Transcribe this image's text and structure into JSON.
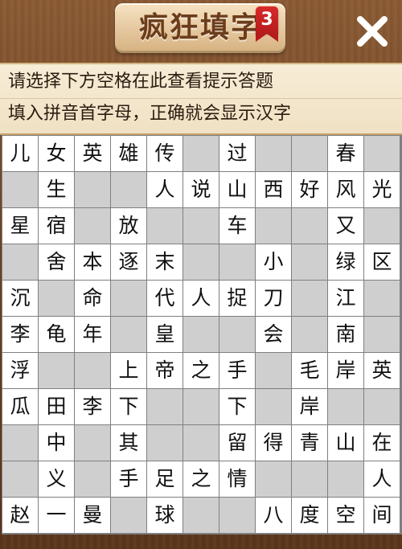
{
  "header": {
    "title": "疯狂填字",
    "level": "3"
  },
  "icons": {
    "close": "close-icon"
  },
  "hint": {
    "line1": "请选择下方空格在此查看提示答题",
    "line2": "填入拼音首字母，正确就会显示汉字"
  },
  "grid": {
    "cols": 11,
    "rows": [
      [
        "儿",
        "女",
        "英",
        "雄",
        "传",
        "",
        "过",
        "",
        "",
        "春",
        ""
      ],
      [
        "",
        "生",
        "",
        "",
        "人",
        "说",
        "山",
        "西",
        "好",
        "风",
        "光"
      ],
      [
        "星",
        "宿",
        "",
        "放",
        "",
        "",
        "车",
        "",
        "",
        "又",
        ""
      ],
      [
        "",
        "舍",
        "本",
        "逐",
        "末",
        "",
        "",
        "小",
        "",
        "绿",
        "区"
      ],
      [
        "沉",
        "",
        "命",
        "",
        "代",
        "人",
        "捉",
        "刀",
        "",
        "江",
        ""
      ],
      [
        "李",
        "龟",
        "年",
        "",
        "皇",
        "",
        "",
        "会",
        "",
        "南",
        ""
      ],
      [
        "浮",
        "",
        "",
        "上",
        "帝",
        "之",
        "手",
        "",
        "毛",
        "岸",
        "英"
      ],
      [
        "瓜",
        "田",
        "李",
        "下",
        "",
        "",
        "下",
        "",
        "岸",
        "",
        ""
      ],
      [
        "",
        "中",
        "",
        "其",
        "",
        "",
        "留",
        "得",
        "青",
        "山",
        "在"
      ],
      [
        "",
        "义",
        "",
        "手",
        "足",
        "之",
        "情",
        "",
        "",
        "",
        "人"
      ],
      [
        "赵",
        "一",
        "曼",
        "",
        "球",
        "",
        "",
        "八",
        "度",
        "空",
        "间"
      ]
    ],
    "blocks": [
      [
        0,
        5
      ],
      [
        0,
        7
      ],
      [
        0,
        8
      ],
      [
        0,
        10
      ],
      [
        1,
        0
      ],
      [
        1,
        2
      ],
      [
        1,
        3
      ],
      [
        2,
        2
      ],
      [
        2,
        4
      ],
      [
        2,
        5
      ],
      [
        2,
        7
      ],
      [
        2,
        8
      ],
      [
        2,
        10
      ],
      [
        3,
        0
      ],
      [
        3,
        5
      ],
      [
        3,
        6
      ],
      [
        3,
        8
      ],
      [
        4,
        1
      ],
      [
        4,
        3
      ],
      [
        4,
        8
      ],
      [
        4,
        10
      ],
      [
        5,
        3
      ],
      [
        5,
        5
      ],
      [
        5,
        6
      ],
      [
        5,
        8
      ],
      [
        5,
        10
      ],
      [
        6,
        1
      ],
      [
        6,
        2
      ],
      [
        6,
        7
      ],
      [
        7,
        4
      ],
      [
        7,
        5
      ],
      [
        7,
        7
      ],
      [
        7,
        9
      ],
      [
        7,
        10
      ],
      [
        8,
        0
      ],
      [
        8,
        2
      ],
      [
        8,
        4
      ],
      [
        8,
        5
      ],
      [
        9,
        0
      ],
      [
        9,
        2
      ],
      [
        9,
        7
      ],
      [
        9,
        8
      ],
      [
        9,
        9
      ],
      [
        10,
        3
      ],
      [
        10,
        5
      ],
      [
        10,
        6
      ]
    ]
  }
}
